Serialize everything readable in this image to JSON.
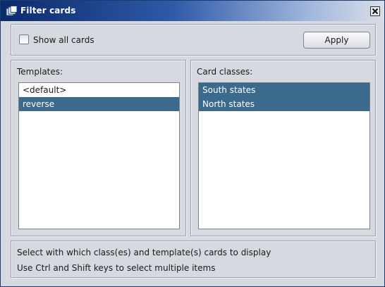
{
  "window": {
    "title": "Filter cards"
  },
  "top": {
    "show_all_label": "Show all cards",
    "show_all_checked": false,
    "apply_label": "Apply"
  },
  "templates": {
    "label": "Templates:",
    "items": [
      {
        "label": "<default>",
        "selected": false
      },
      {
        "label": "reverse",
        "selected": true
      }
    ]
  },
  "card_classes": {
    "label": "Card classes:",
    "items": [
      {
        "label": "South states",
        "selected": true
      },
      {
        "label": "North states",
        "selected": true
      }
    ]
  },
  "info": {
    "line1": "Select with which class(es) and template(s) cards to display",
    "line2": "Use Ctrl and Shift keys to select multiple items"
  },
  "colors": {
    "selection": "#3c6a8c",
    "title_start": "#0b2a6b",
    "background": "#d6d9df"
  },
  "icons": {
    "title": "cards-icon",
    "close": "close-icon"
  }
}
